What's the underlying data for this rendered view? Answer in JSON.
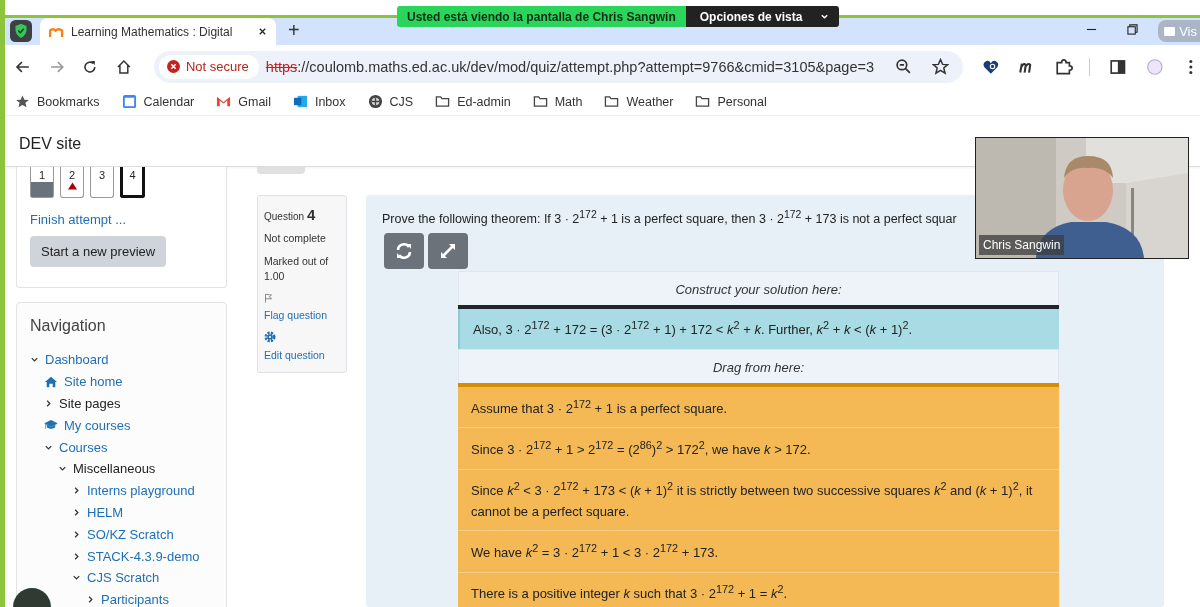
{
  "share_banner": {
    "message": "Usted está viendo la pantalla de Chris Sangwin",
    "options": "Opciones de vista"
  },
  "tabs": [
    {
      "title": "Learning Mathematics : Digital",
      "selected": true
    }
  ],
  "new_tab": "+",
  "overlay_button": "Vis",
  "address_bar": {
    "security": "Not secure",
    "scheme": "https",
    "url": "://coulomb.maths.ed.ac.uk/dev/mod/quiz/attempt.php?attempt=9766&cmid=3105&page=3"
  },
  "bookmarks": [
    {
      "label": "Bookmarks",
      "kind": "star"
    },
    {
      "label": "Calendar",
      "kind": "calendar"
    },
    {
      "label": "Gmail",
      "kind": "mail"
    },
    {
      "label": "Inbox",
      "kind": "inbox"
    },
    {
      "label": "CJS",
      "kind": "crest"
    },
    {
      "label": "Ed-admin",
      "kind": "folder"
    },
    {
      "label": "Math",
      "kind": "folder"
    },
    {
      "label": "Weather",
      "kind": "folder"
    },
    {
      "label": "Personal",
      "kind": "folder"
    }
  ],
  "site_title": "DEV site",
  "quiz_nav": {
    "questions": [
      {
        "label": "1",
        "answered": true,
        "flagged": false,
        "selected": false
      },
      {
        "label": "2",
        "answered": false,
        "flagged": true,
        "selected": false
      },
      {
        "label": "3",
        "answered": false,
        "flagged": false,
        "selected": false
      },
      {
        "label": "4",
        "answered": false,
        "flagged": false,
        "selected": true
      }
    ],
    "finish_link": "Finish attempt ...",
    "new_preview_button": "Start a new preview"
  },
  "navigation": {
    "title": "Navigation",
    "items": [
      {
        "label": "Dashboard",
        "kind": "branch",
        "link": true,
        "expanded": true,
        "children": [
          {
            "label": "Site home",
            "kind": "home",
            "link": true
          },
          {
            "label": "Site pages",
            "kind": "branch",
            "link": false,
            "expanded": false
          },
          {
            "label": "My courses",
            "kind": "courses",
            "link": true
          },
          {
            "label": "Courses",
            "kind": "branch",
            "link": true,
            "expanded": true,
            "children": [
              {
                "label": "Miscellaneous",
                "kind": "branch",
                "link": false,
                "expanded": true,
                "children": [
                  {
                    "label": "Interns playground",
                    "kind": "branch",
                    "link": true,
                    "expanded": false
                  },
                  {
                    "label": "HELM",
                    "kind": "branch",
                    "link": true,
                    "expanded": false
                  },
                  {
                    "label": "SO/KZ Scratch",
                    "kind": "branch",
                    "link": true,
                    "expanded": false
                  },
                  {
                    "label": "STACK-4.3.9-demo",
                    "kind": "branch",
                    "link": true,
                    "expanded": false
                  },
                  {
                    "label": "CJS Scratch",
                    "kind": "branch",
                    "link": true,
                    "expanded": true,
                    "children": [
                      {
                        "label": "Participants",
                        "kind": "branch",
                        "link": true,
                        "expanded": false
                      }
                    ]
                  }
                ]
              }
            ]
          }
        ]
      }
    ]
  },
  "question_info": {
    "label": "Question",
    "number": "4",
    "status": "Not complete",
    "marks": "Marked out of 1.00",
    "flag": "Flag question",
    "edit": "Edit question"
  },
  "question": {
    "prompt": "Prove the following theorem: If 3 · 2$^{172}$ + 1 is a perfect square, then 3 · 2$^{172}$ + 173 is not a perfect squar",
    "construct_heading": "Construct your solution here:",
    "construct_items": [
      "Also, 3 · 2$^{172}$ + 172 = (3 · 2$^{172}$ + 1) + 172 < *k*$^{2}$ + *k*. Further, *k*$^{2}$ + *k* < (*k* + 1)$^{2}$."
    ],
    "drag_heading": "Drag from here:",
    "drag_items": [
      "Assume that 3 · 2$^{172}$ + 1 is a perfect square.",
      "Since 3 · 2$^{172}$ + 1 > 2$^{172}$ = (2$^{86}$)$^{2}$ > 172$^{2}$, we have *k* > 172.",
      "Since *k*$^{2}$ < 3 · 2$^{172}$ + 173 < (*k* + 1)$^{2}$ it is strictly between two successive squares *k*$^{2}$ and (*k* + 1)$^{2}$, it cannot be a perfect square.",
      "We have *k*$^{2}$ = 3 · 2$^{172}$ + 1 < 3 · 2$^{172}$ + 173.",
      "There is a positive integer *k* such that 3 · 2$^{172}$ + 1 = *k*$^{2}$."
    ]
  },
  "video": {
    "name": "Chris Sangwin"
  }
}
